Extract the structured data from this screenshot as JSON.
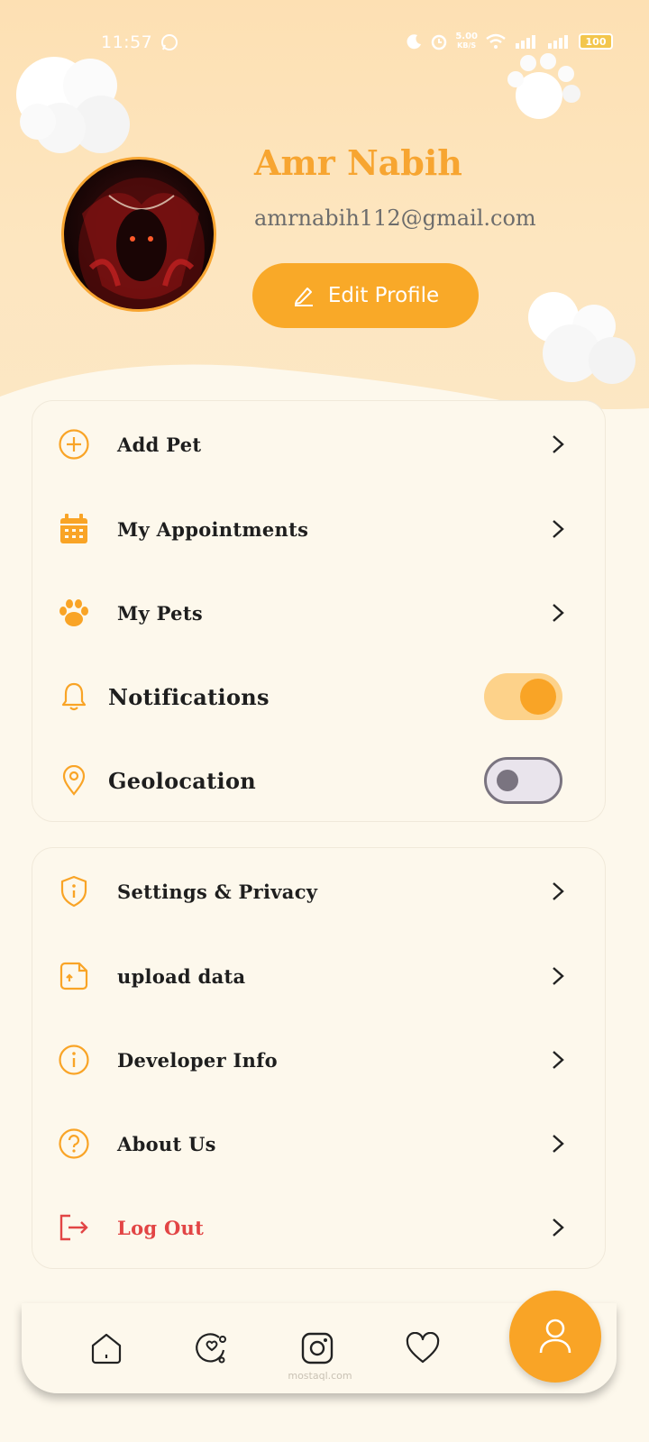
{
  "status_bar": {
    "time": "11:57",
    "speed_value": "5.00",
    "speed_unit": "KB/S",
    "battery": "100",
    "icons": [
      "whatsapp-icon",
      "moon-icon",
      "alarm-icon",
      "wifi-icon",
      "signal-icon",
      "signal-icon",
      "battery-icon"
    ]
  },
  "profile": {
    "name": "Amr Nabih",
    "email": "amrnabih112@gmail.com",
    "edit_label": "Edit Profile",
    "edit_icon": "pencil-icon"
  },
  "menu_main": [
    {
      "label": "Add Pet",
      "icon": "add-circle-icon"
    },
    {
      "label": "My Appointments",
      "icon": "calendar-icon"
    },
    {
      "label": "My Pets",
      "icon": "paw-icon"
    }
  ],
  "toggles": [
    {
      "label": "Notifications",
      "icon": "bell-icon",
      "on": true
    },
    {
      "label": "Geolocation",
      "icon": "location-pin-icon",
      "on": false
    }
  ],
  "menu_settings": [
    {
      "label": "Settings & Privacy",
      "icon": "shield-info-icon"
    },
    {
      "label": "upload data",
      "icon": "upload-file-icon"
    },
    {
      "label": "Developer Info",
      "icon": "info-icon"
    },
    {
      "label": "About Us",
      "icon": "question-icon"
    },
    {
      "label": "Log Out",
      "icon": "logout-icon"
    }
  ],
  "bottom_nav": {
    "items": [
      "home-icon",
      "discover-icon",
      "instagram-icon",
      "heart-icon"
    ],
    "active": "profile-icon"
  },
  "watermark": {
    "text": "mostaql.com"
  },
  "colors": {
    "accent": "#f9a426",
    "name": "#f7a531",
    "logout": "#e24545",
    "background": "#fdf8ec"
  }
}
